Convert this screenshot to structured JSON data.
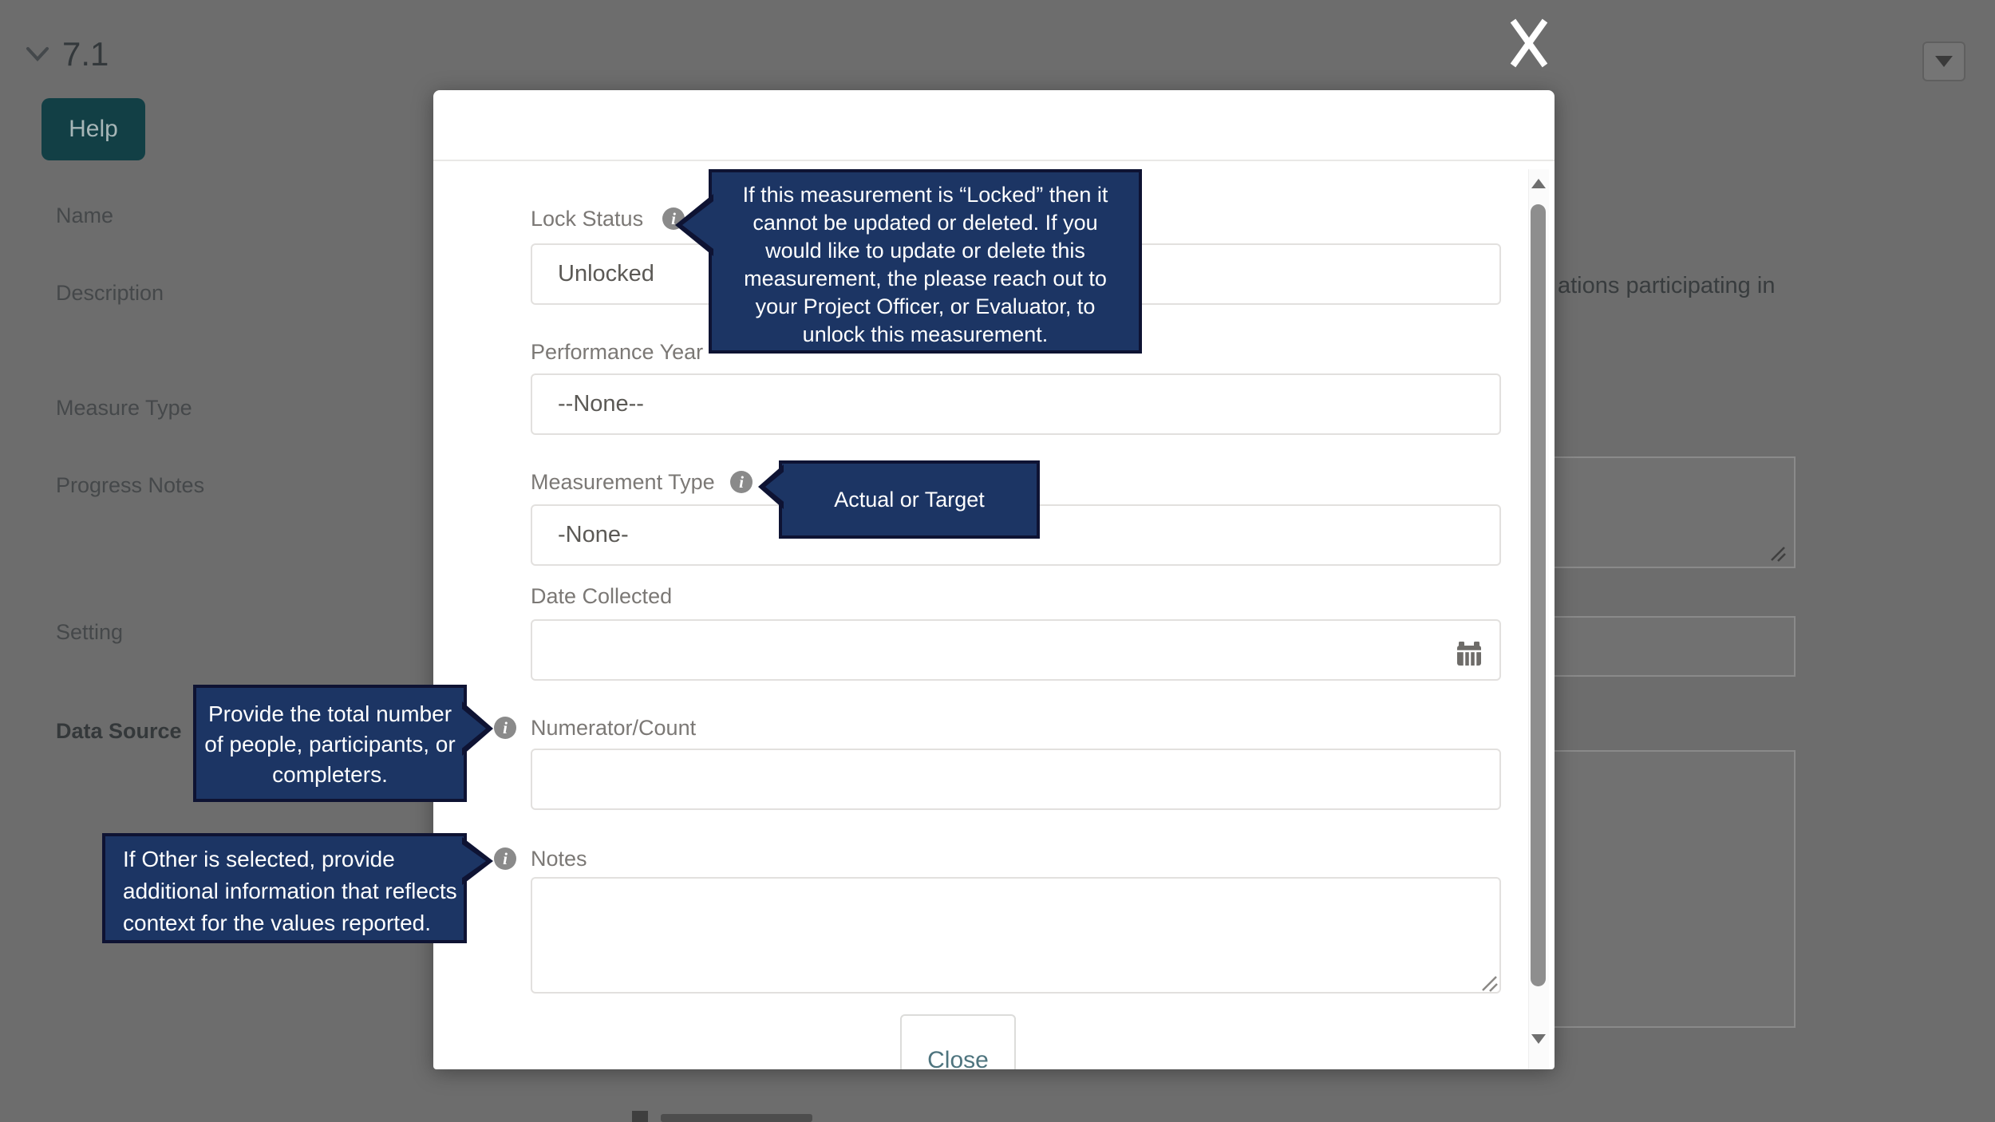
{
  "colors": {
    "overlay": "#6d6d6d",
    "tooltip_bg": "#1c3564",
    "tooltip_border": "#0e1333",
    "help_button_bg": "#123f45",
    "close_text_teal": "#4e747e"
  },
  "background": {
    "section_label": "7.1",
    "help_button_label": "Help",
    "left_labels": {
      "name": "Name",
      "description": "Description",
      "measure_type": "Measure Type",
      "progress_notes": "Progress Notes",
      "setting": "Setting",
      "data_source": "Data Source"
    },
    "description_fragment": "ations participating in"
  },
  "modal": {
    "fields": {
      "lock_status": {
        "label": "Lock Status",
        "value": "Unlocked"
      },
      "performance_year": {
        "label": "Performance Year",
        "value": "--None--"
      },
      "measurement_type": {
        "label": "Measurement Type",
        "value": "-None-"
      },
      "date_collected": {
        "label": "Date Collected",
        "value": ""
      },
      "numerator": {
        "label": "Numerator/Count",
        "value": ""
      },
      "notes": {
        "label": "Notes",
        "value": ""
      }
    },
    "close_button_label": "Close"
  },
  "tooltips": {
    "lock_status": {
      "lines": [
        "If this measurement is “Locked” then it",
        "cannot be updated or deleted. If you",
        "would like to update or delete this",
        "measurement, the please reach out to",
        "your Project Officer, or Evaluator, to",
        "unlock this measurement."
      ]
    },
    "measurement_type": {
      "lines": [
        "Actual or Target"
      ]
    },
    "numerator": {
      "lines": [
        "Provide the total number",
        "of people, participants, or",
        "completers."
      ]
    },
    "notes": {
      "lines": [
        "If Other is selected, provide",
        "additional information that reflects",
        "context for the values reported."
      ]
    }
  }
}
